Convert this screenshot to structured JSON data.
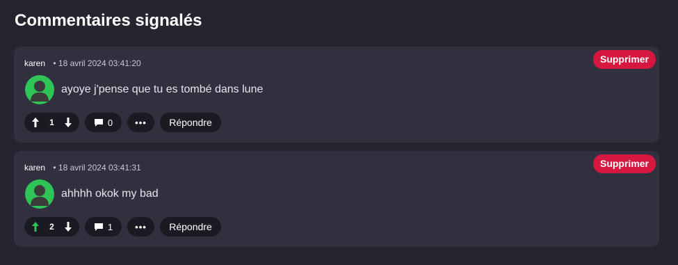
{
  "page": {
    "title": "Commentaires signalés"
  },
  "comments": [
    {
      "author": "karen",
      "date": "• 18 avril 2024 03:41:20",
      "delete_label": "Supprimer",
      "text": "ayoye j'pense que tu es tombé dans lune",
      "votes": "1",
      "upvoted": false,
      "comment_count": "0",
      "more_label": "•••",
      "reply_label": "Répondre"
    },
    {
      "author": "karen",
      "date": "• 18 avril 2024 03:41:31",
      "delete_label": "Supprimer",
      "text": "ahhhh okok my bad",
      "votes": "2",
      "upvoted": true,
      "comment_count": "1",
      "more_label": "•••",
      "reply_label": "Répondre"
    }
  ],
  "colors": {
    "background": "#25242f",
    "card": "#31303f",
    "delete": "#d6173f",
    "avatar": "#2ec456",
    "upvote_active": "#2ec456"
  },
  "icons": {
    "upvote": "arrow-up-icon",
    "downvote": "arrow-down-icon",
    "comment": "speech-bubble-icon",
    "avatar": "user-avatar-icon"
  }
}
